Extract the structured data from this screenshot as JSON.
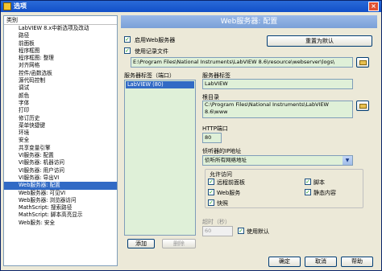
{
  "window": {
    "title": "选项",
    "close_glyph": "×"
  },
  "categories": {
    "header": "类别",
    "items": [
      "LabVIEW 8.x中新选项及改动",
      "路径",
      "前面板",
      "程序框图",
      "程序框图: 整理",
      "对齐网格",
      "控件/函数选板",
      "源代码控制",
      "调试",
      "颜色",
      "字体",
      "打印",
      "修订历史",
      "菜单快捷键",
      "环境",
      "安全",
      "共享变量引擎",
      "VI服务器: 配置",
      "VI服务器: 机器访问",
      "VI服务器: 用户访问",
      "VI服务器: 导出VI",
      "Web服务器: 配置",
      "Web服务器: 可见VI",
      "Web服务器: 浏览器访问",
      "MathScript: 搜索路径",
      "MathScript: 脚本高亮显示",
      "Web服务: 安全"
    ],
    "selected": "Web服务器: 配置"
  },
  "panel": {
    "title": "Web服务器: 配置",
    "enable_server": "启用Web服务器",
    "reset_default": "重置为默认",
    "use_log": "使用记录文件",
    "log_path": "E:\\Program Files\\National Instruments\\LabVIEW 8.6\\resource\\webserver\\logs\\",
    "server_list_label": "服务器标签（端口）",
    "server_list_item": "LabVIEW (80)",
    "server_label_title": "服务器标签",
    "server_label_value": "LabVIEW",
    "root_dir_title": "根目录",
    "root_dir_value": "C:\\Program Files\\National Instruments\\LabVIEW 8.6\\www",
    "port_title": "HTTP端口",
    "port_value": "80",
    "listen_title": "侦听器的IP地址",
    "listen_value": "侦听所有网络地址",
    "allow_title": "允许访问",
    "allow_remote_panel": "远程前面板",
    "allow_script": "脚本",
    "allow_web_service": "Web服务",
    "allow_static": "静态内容",
    "allow_snapshot": "快照",
    "timeout_title": "超时（秒）",
    "timeout_value": "60",
    "use_default": "使用默认",
    "add": "添加",
    "delete": "删除",
    "ok": "确定",
    "cancel": "取消",
    "help": "帮助",
    "check_glyph": "✓",
    "dropdown_glyph": "▼"
  }
}
